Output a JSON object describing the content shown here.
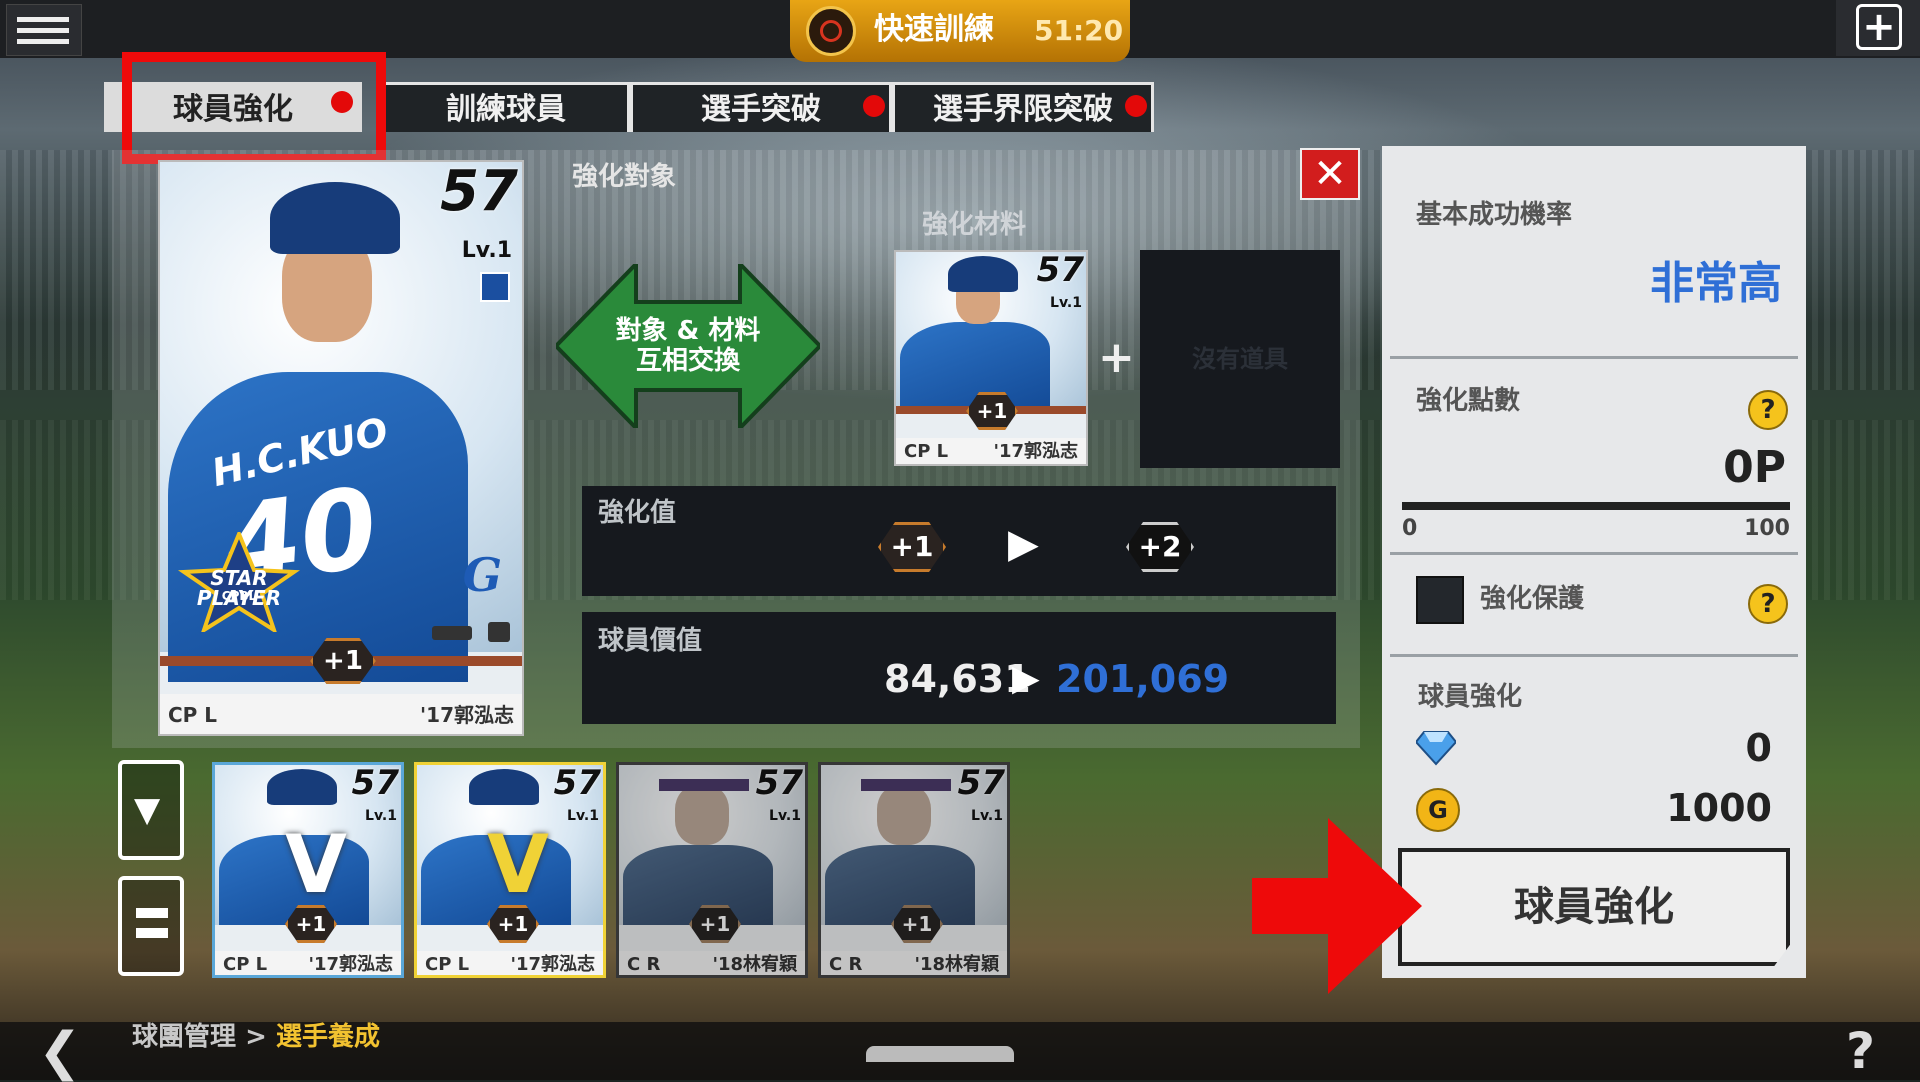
{
  "header": {
    "quick_training_label": "快速訓練",
    "quick_training_timer": "51:20"
  },
  "tabs": [
    {
      "label": "球員強化",
      "active": true,
      "alert": true
    },
    {
      "label": "訓練球員",
      "active": false,
      "alert": false
    },
    {
      "label": "選手突破",
      "active": false,
      "alert": true
    },
    {
      "label": "選手界限突破",
      "active": false,
      "alert": true
    }
  ],
  "target": {
    "section_label": "強化對象",
    "card": {
      "rating": "57",
      "level": "Lv.1",
      "jersey_name": "H.C.KUO",
      "jersey_number": "40",
      "badge": "STAR PLAYER",
      "badge_sub": "CPBL",
      "plus": "+1",
      "position": "CP L",
      "name": "'17郭泓志"
    }
  },
  "swap_button": {
    "line1": "對象 & 材料",
    "line2": "互相交換"
  },
  "materials": {
    "section_label": "強化材料",
    "card": {
      "rating": "57",
      "level": "Lv.1",
      "plus": "+1",
      "position": "CP L",
      "name": "'17郭泓志"
    },
    "plus_sign": "+",
    "empty_slot": "沒有道具"
  },
  "enhance_value": {
    "label": "強化值",
    "from": "+1",
    "to": "+2"
  },
  "player_value": {
    "label": "球員價值",
    "from": "84,631",
    "to": "201,069"
  },
  "inventory": [
    {
      "rating": "57",
      "level": "Lv.1",
      "plus": "+1",
      "position": "CP L",
      "name": "'17郭泓志",
      "frame": "#5aa7d8",
      "v": true
    },
    {
      "rating": "57",
      "level": "Lv.1",
      "plus": "+1",
      "position": "CP L",
      "name": "'17郭泓志",
      "frame": "#f0d236",
      "v": true
    },
    {
      "rating": "57",
      "level": "Lv.1",
      "plus": "+1",
      "position": "C R",
      "name": "'18林宥穎",
      "frame": "#444444",
      "v": false
    },
    {
      "rating": "57",
      "level": "Lv.1",
      "plus": "+1",
      "position": "C R",
      "name": "'18林宥穎",
      "frame": "#444444",
      "v": false
    }
  ],
  "right_panel": {
    "success_rate_label": "基本成功機率",
    "success_rate_value": "非常高",
    "points_label": "強化點數",
    "points_value": "0P",
    "points_min": "0",
    "points_max": "100",
    "points_progress": 0,
    "protect_label": "強化保護",
    "protect_checked": false,
    "cost_label": "球員強化",
    "diamond_cost": "0",
    "gold_cost": "1000",
    "gold_icon_letter": "G",
    "enhance_button": "球員強化",
    "help_symbol": "?"
  },
  "breadcrumb": {
    "parent": "球團管理",
    "separator": ">",
    "current": "選手養成"
  },
  "footer": {
    "help": "?"
  },
  "colors": {
    "accent_blue": "#2f6fd6",
    "gold": "#f2b516",
    "alert_red": "#e30909",
    "highlight_red": "#ee0a0a"
  }
}
